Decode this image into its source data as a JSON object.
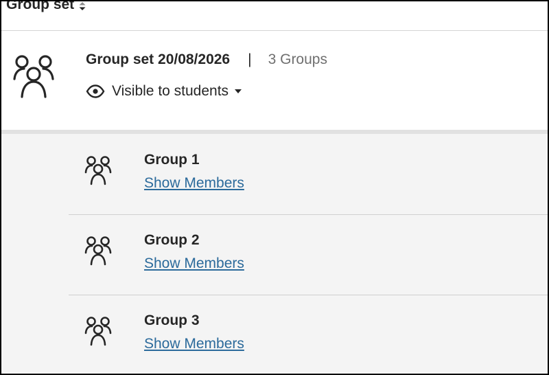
{
  "header": {
    "column_label": "Group set",
    "sort_icon": "sort-icon"
  },
  "group_set": {
    "title": "Group set 20/08/2026",
    "separator": "|",
    "count": "3 Groups",
    "visibility_label": "Visible to students",
    "icon": "group-set-icon",
    "colors": {
      "count_text": "#6f6f6f"
    }
  },
  "groups": [
    {
      "name": "Group 1",
      "link": "Show Members",
      "icon": "group-icon"
    },
    {
      "name": "Group 2",
      "link": "Show Members",
      "icon": "group-icon"
    },
    {
      "name": "Group 3",
      "link": "Show Members",
      "icon": "group-icon"
    }
  ],
  "colors": {
    "link": "#2b6a9b",
    "list_background": "#f4f4f4",
    "divider": "#e1e1e1"
  }
}
